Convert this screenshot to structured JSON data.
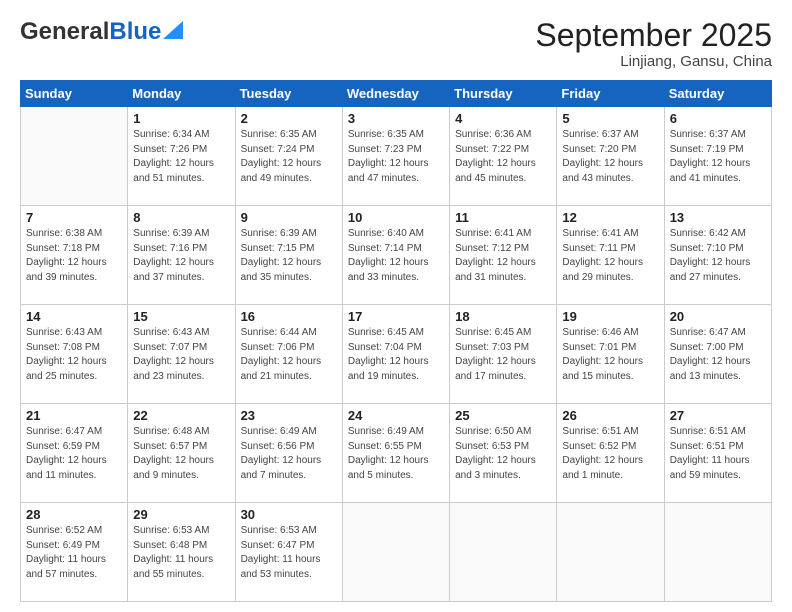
{
  "logo": {
    "general": "General",
    "blue": "Blue"
  },
  "header": {
    "month": "September 2025",
    "location": "Linjiang, Gansu, China"
  },
  "weekdays": [
    "Sunday",
    "Monday",
    "Tuesday",
    "Wednesday",
    "Thursday",
    "Friday",
    "Saturday"
  ],
  "weeks": [
    [
      {
        "day": "",
        "info": ""
      },
      {
        "day": "1",
        "info": "Sunrise: 6:34 AM\nSunset: 7:26 PM\nDaylight: 12 hours\nand 51 minutes."
      },
      {
        "day": "2",
        "info": "Sunrise: 6:35 AM\nSunset: 7:24 PM\nDaylight: 12 hours\nand 49 minutes."
      },
      {
        "day": "3",
        "info": "Sunrise: 6:35 AM\nSunset: 7:23 PM\nDaylight: 12 hours\nand 47 minutes."
      },
      {
        "day": "4",
        "info": "Sunrise: 6:36 AM\nSunset: 7:22 PM\nDaylight: 12 hours\nand 45 minutes."
      },
      {
        "day": "5",
        "info": "Sunrise: 6:37 AM\nSunset: 7:20 PM\nDaylight: 12 hours\nand 43 minutes."
      },
      {
        "day": "6",
        "info": "Sunrise: 6:37 AM\nSunset: 7:19 PM\nDaylight: 12 hours\nand 41 minutes."
      }
    ],
    [
      {
        "day": "7",
        "info": "Sunrise: 6:38 AM\nSunset: 7:18 PM\nDaylight: 12 hours\nand 39 minutes."
      },
      {
        "day": "8",
        "info": "Sunrise: 6:39 AM\nSunset: 7:16 PM\nDaylight: 12 hours\nand 37 minutes."
      },
      {
        "day": "9",
        "info": "Sunrise: 6:39 AM\nSunset: 7:15 PM\nDaylight: 12 hours\nand 35 minutes."
      },
      {
        "day": "10",
        "info": "Sunrise: 6:40 AM\nSunset: 7:14 PM\nDaylight: 12 hours\nand 33 minutes."
      },
      {
        "day": "11",
        "info": "Sunrise: 6:41 AM\nSunset: 7:12 PM\nDaylight: 12 hours\nand 31 minutes."
      },
      {
        "day": "12",
        "info": "Sunrise: 6:41 AM\nSunset: 7:11 PM\nDaylight: 12 hours\nand 29 minutes."
      },
      {
        "day": "13",
        "info": "Sunrise: 6:42 AM\nSunset: 7:10 PM\nDaylight: 12 hours\nand 27 minutes."
      }
    ],
    [
      {
        "day": "14",
        "info": "Sunrise: 6:43 AM\nSunset: 7:08 PM\nDaylight: 12 hours\nand 25 minutes."
      },
      {
        "day": "15",
        "info": "Sunrise: 6:43 AM\nSunset: 7:07 PM\nDaylight: 12 hours\nand 23 minutes."
      },
      {
        "day": "16",
        "info": "Sunrise: 6:44 AM\nSunset: 7:06 PM\nDaylight: 12 hours\nand 21 minutes."
      },
      {
        "day": "17",
        "info": "Sunrise: 6:45 AM\nSunset: 7:04 PM\nDaylight: 12 hours\nand 19 minutes."
      },
      {
        "day": "18",
        "info": "Sunrise: 6:45 AM\nSunset: 7:03 PM\nDaylight: 12 hours\nand 17 minutes."
      },
      {
        "day": "19",
        "info": "Sunrise: 6:46 AM\nSunset: 7:01 PM\nDaylight: 12 hours\nand 15 minutes."
      },
      {
        "day": "20",
        "info": "Sunrise: 6:47 AM\nSunset: 7:00 PM\nDaylight: 12 hours\nand 13 minutes."
      }
    ],
    [
      {
        "day": "21",
        "info": "Sunrise: 6:47 AM\nSunset: 6:59 PM\nDaylight: 12 hours\nand 11 minutes."
      },
      {
        "day": "22",
        "info": "Sunrise: 6:48 AM\nSunset: 6:57 PM\nDaylight: 12 hours\nand 9 minutes."
      },
      {
        "day": "23",
        "info": "Sunrise: 6:49 AM\nSunset: 6:56 PM\nDaylight: 12 hours\nand 7 minutes."
      },
      {
        "day": "24",
        "info": "Sunrise: 6:49 AM\nSunset: 6:55 PM\nDaylight: 12 hours\nand 5 minutes."
      },
      {
        "day": "25",
        "info": "Sunrise: 6:50 AM\nSunset: 6:53 PM\nDaylight: 12 hours\nand 3 minutes."
      },
      {
        "day": "26",
        "info": "Sunrise: 6:51 AM\nSunset: 6:52 PM\nDaylight: 12 hours\nand 1 minute."
      },
      {
        "day": "27",
        "info": "Sunrise: 6:51 AM\nSunset: 6:51 PM\nDaylight: 11 hours\nand 59 minutes."
      }
    ],
    [
      {
        "day": "28",
        "info": "Sunrise: 6:52 AM\nSunset: 6:49 PM\nDaylight: 11 hours\nand 57 minutes."
      },
      {
        "day": "29",
        "info": "Sunrise: 6:53 AM\nSunset: 6:48 PM\nDaylight: 11 hours\nand 55 minutes."
      },
      {
        "day": "30",
        "info": "Sunrise: 6:53 AM\nSunset: 6:47 PM\nDaylight: 11 hours\nand 53 minutes."
      },
      {
        "day": "",
        "info": ""
      },
      {
        "day": "",
        "info": ""
      },
      {
        "day": "",
        "info": ""
      },
      {
        "day": "",
        "info": ""
      }
    ]
  ]
}
